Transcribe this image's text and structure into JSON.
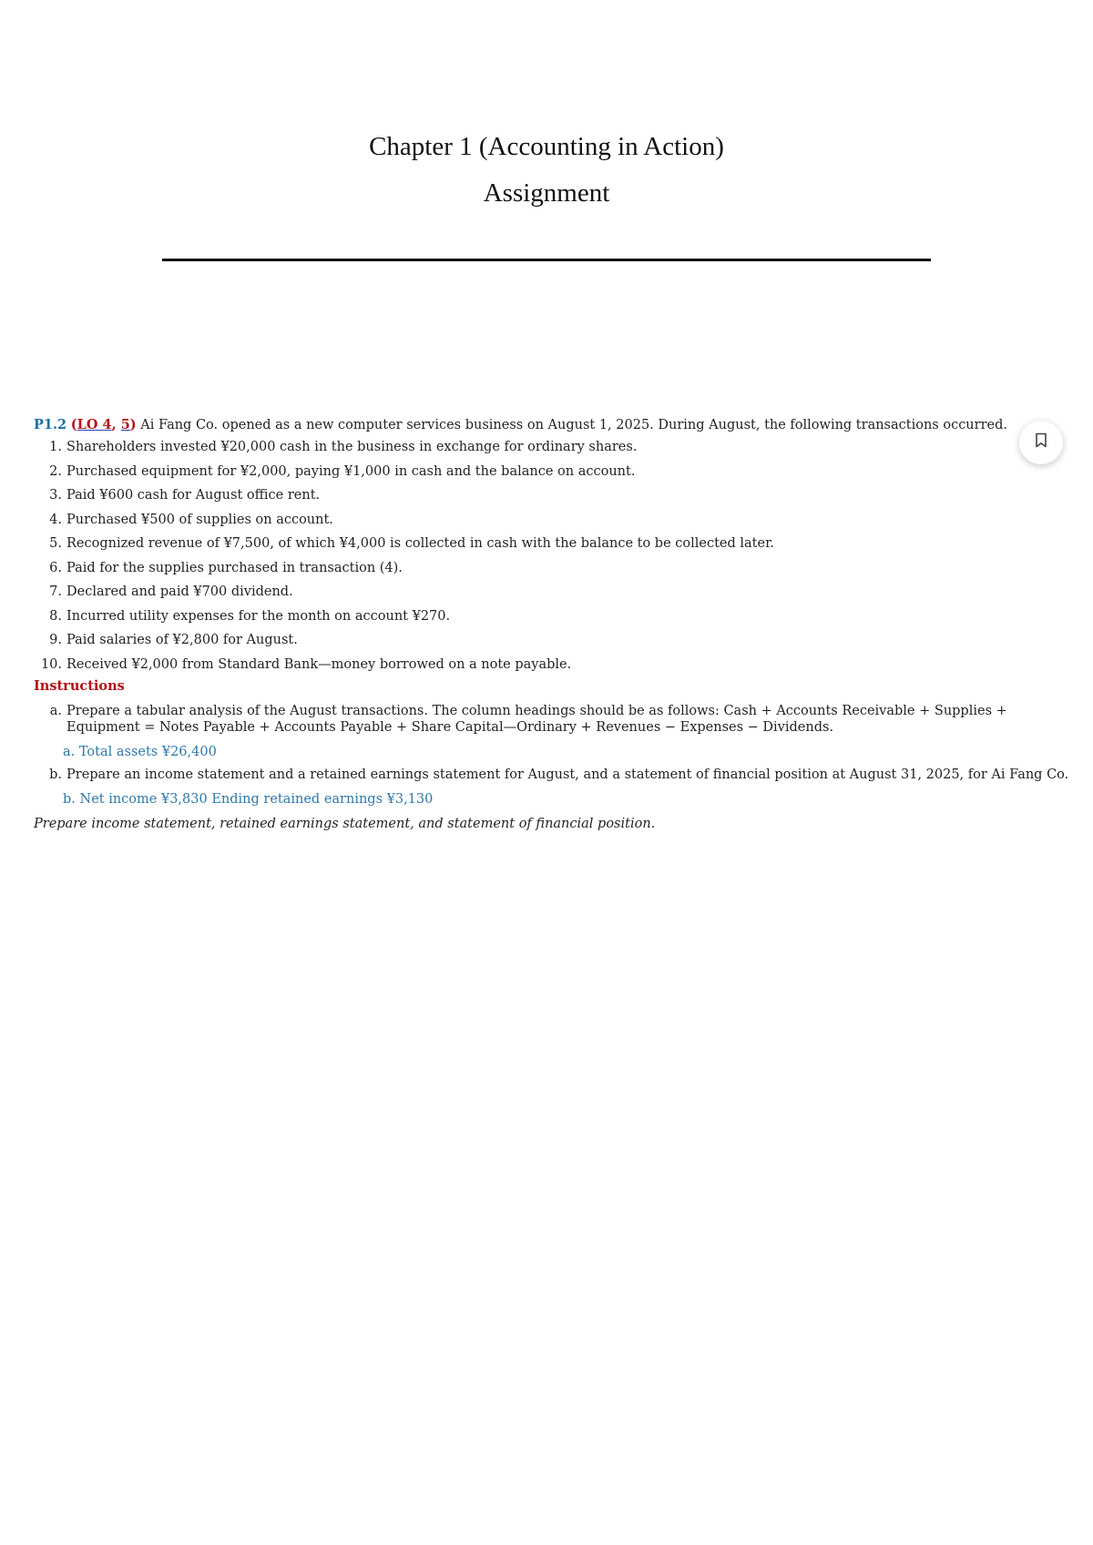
{
  "header": {
    "title_line1": "Chapter 1 (Accounting in Action)",
    "title_line2": "Assignment"
  },
  "problem": {
    "number": "P1.2",
    "lo_open": "(",
    "lo_link_1": "LO 4",
    "lo_sep": ", ",
    "lo_link_2": "5",
    "lo_close": ")",
    "intro": "Ai Fang Co. opened as a new computer services business on August 1, 2025. During August, the following transactions occurred.",
    "transactions": [
      {
        "num": "1.",
        "text": "Shareholders invested ¥20,000 cash in the business in exchange for ordinary shares."
      },
      {
        "num": "2.",
        "text": "Purchased equipment for ¥2,000, paying ¥1,000 in cash and the balance on account."
      },
      {
        "num": "3.",
        "text": "Paid ¥600 cash for August office rent."
      },
      {
        "num": "4.",
        "text": "Purchased ¥500 of supplies on account."
      },
      {
        "num": "5.",
        "text": "Recognized revenue of ¥7,500, of which ¥4,000 is collected in cash with the balance to be collected later."
      },
      {
        "num": "6.",
        "text": "Paid for the supplies purchased in transaction (4)."
      },
      {
        "num": "7.",
        "text": "Declared and paid ¥700 dividend."
      },
      {
        "num": "8.",
        "text": "Incurred utility expenses for the month on account ¥270."
      },
      {
        "num": "9.",
        "text": "Paid salaries of ¥2,800 for August."
      },
      {
        "num": "10.",
        "text": "Received ¥2,000 from Standard Bank—money borrowed on a note payable."
      }
    ],
    "instructions_heading": "Instructions",
    "instructions": [
      {
        "num": "a.",
        "text": "Prepare a tabular analysis of the August transactions. The column headings should be as follows: Cash + Accounts Receivable + Supplies + Equipment = Notes Payable + Accounts Payable + Share Capital—Ordinary + Revenues − Expenses − Dividends.",
        "answer": "a. Total assets ¥26,400"
      },
      {
        "num": "b.",
        "text": "Prepare an income statement and a retained earnings statement for August, and a statement of financial position at August 31, 2025, for Ai Fang Co.",
        "answer": "b. Net income ¥3,830 Ending retained earnings ¥3,130"
      }
    ],
    "final_note": "Prepare income statement, retained earnings statement, and statement of financial position."
  },
  "actions": {
    "bookmark_icon": "bookmark-icon"
  }
}
